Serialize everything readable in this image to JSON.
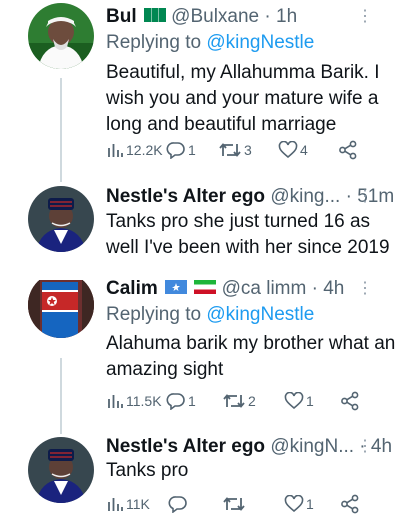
{
  "tweets": [
    {
      "name": "Bul",
      "handle": "@Bulxane · 1h",
      "replying_prefix": "Replying to ",
      "replying_to": "@kingNestle",
      "text": "Beautiful, my Allahumma Barik. I wish you and your mature wife a long and beautiful marriage",
      "views": "12.2K",
      "replies": "1",
      "retweets": "3",
      "likes": "4"
    },
    {
      "name": "Nestle's Alter ego",
      "handle": "@king... · 51m",
      "text": "Tanks pro she just turned 16 as well I've been with her since 2019"
    },
    {
      "name": "Calim",
      "handle": "@ca limm · 4h",
      "replying_prefix": "Replying to ",
      "replying_to": "@kingNestle",
      "text": "Alahuma barik my brother what an amazing sight",
      "views": "11.5K",
      "replies": "1",
      "retweets": "2",
      "likes": "1"
    },
    {
      "name": "Nestle's Alter ego",
      "handle": "@kingN... · 4h",
      "text": "Tanks pro",
      "views": "11K",
      "replies": "",
      "retweets": "",
      "likes": "1"
    }
  ],
  "colors": {
    "text": "#0f1419",
    "secondary": "#536471",
    "link": "#1d9bf0",
    "thread_line": "#cfd9de"
  },
  "icons": [
    "more-icon",
    "views-icon",
    "reply-icon",
    "retweet-icon",
    "like-icon",
    "share-icon"
  ]
}
